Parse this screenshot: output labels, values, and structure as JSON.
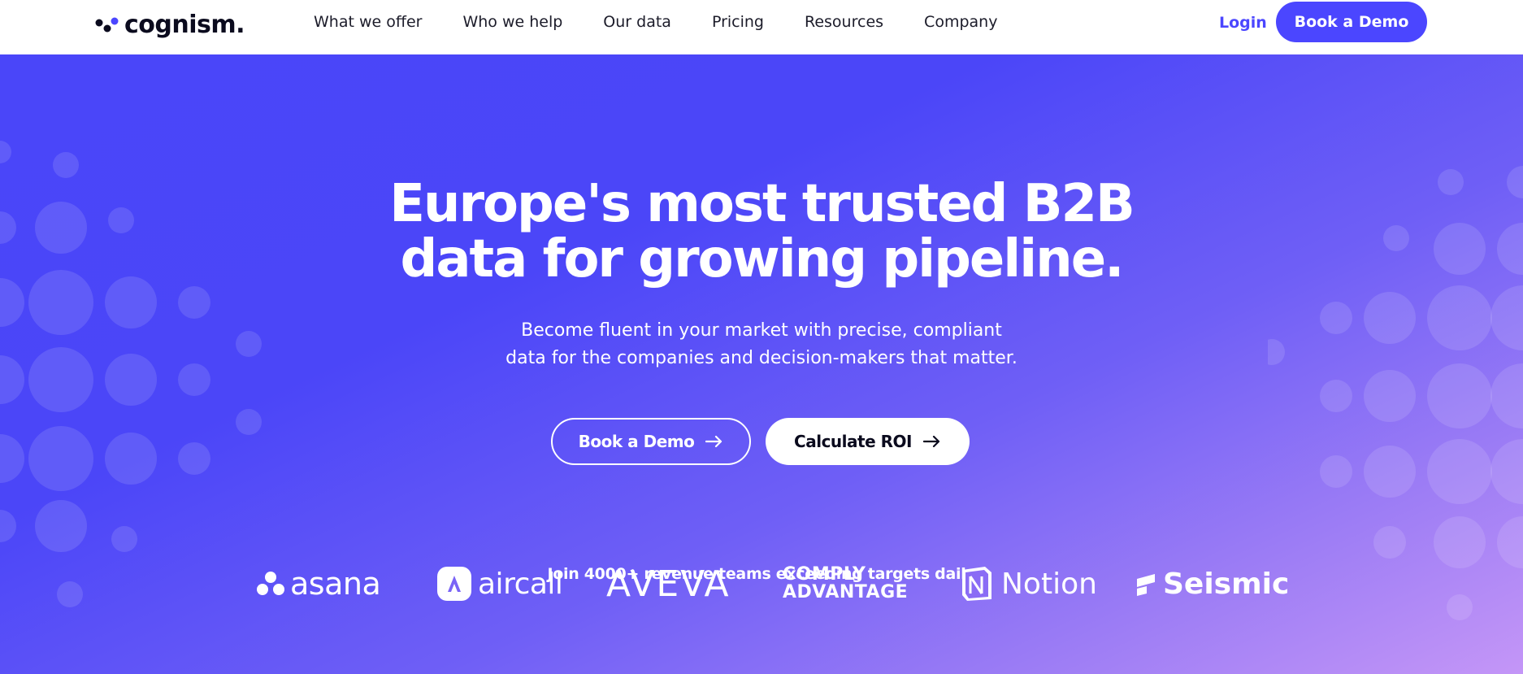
{
  "nav": {
    "logo_text": "cognism.",
    "menu": [
      {
        "label": "What we offer"
      },
      {
        "label": "Who we help"
      },
      {
        "label": "Our data"
      },
      {
        "label": "Pricing"
      },
      {
        "label": "Resources"
      },
      {
        "label": "Company"
      }
    ],
    "login_label": "Login",
    "demo_label": "Book a Demo"
  },
  "hero": {
    "headline_line1": "Europe's most trusted B2B",
    "headline_line2": "data for growing pipeline.",
    "subhead_line1": "Become fluent in your market with precise, compliant",
    "subhead_line2": "data for the companies and decision-makers that matter.",
    "primary_cta": "Book a Demo",
    "secondary_cta": "Calculate ROI",
    "social_proof": "Join 4000+ revenue teams exceeding targets daily"
  },
  "brands": {
    "asana": "asana",
    "aircall": "aircall",
    "aveva": "AVEVA",
    "comply_line1": "COMPLY",
    "comply_line2": "ADVANTAGE",
    "notion": "Notion",
    "seismic": "Seismic"
  },
  "colors": {
    "accent": "#4b46ff",
    "hero_start": "#4a46f9",
    "hero_end": "#c496f7",
    "text_dark": "#0b0b1e"
  },
  "icons": {
    "arrow": "arrow-right-icon",
    "logo_mark": "cognism-mark-icon"
  }
}
